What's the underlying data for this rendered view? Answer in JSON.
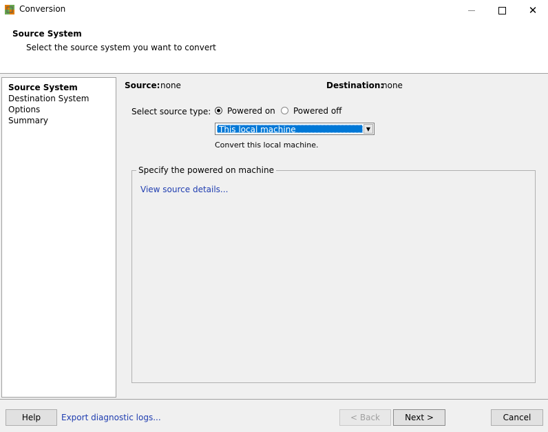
{
  "window": {
    "title": "Conversion",
    "icon": "vmware-converter-icon"
  },
  "header": {
    "title": "Source System",
    "subtitle": "Select the source system you want to convert"
  },
  "nav": {
    "items": [
      {
        "label": "Source System",
        "active": true
      },
      {
        "label": "Destination System",
        "active": false
      },
      {
        "label": "Options",
        "active": false
      },
      {
        "label": "Summary",
        "active": false
      }
    ]
  },
  "main": {
    "source_label": "Source:",
    "source_value": "none",
    "destination_label": "Destination:",
    "destination_value": "none",
    "select_type_label": "Select source type:",
    "powered_on_label": "Powered on",
    "powered_off_label": "Powered off",
    "selected_type": "Powered on",
    "dropdown_value": "This local machine",
    "convert_note": "Convert this local machine.",
    "group_title": "Specify the powered on machine",
    "view_details_link": "View source details..."
  },
  "footer": {
    "help_label": "Help",
    "export_label": "Export diagnostic logs...",
    "back_label": "< Back",
    "next_label": "Next >",
    "cancel_label": "Cancel"
  },
  "colors": {
    "selection": "#0078d7",
    "link": "#1f3db0",
    "panel_bg": "#f0f0f0"
  }
}
